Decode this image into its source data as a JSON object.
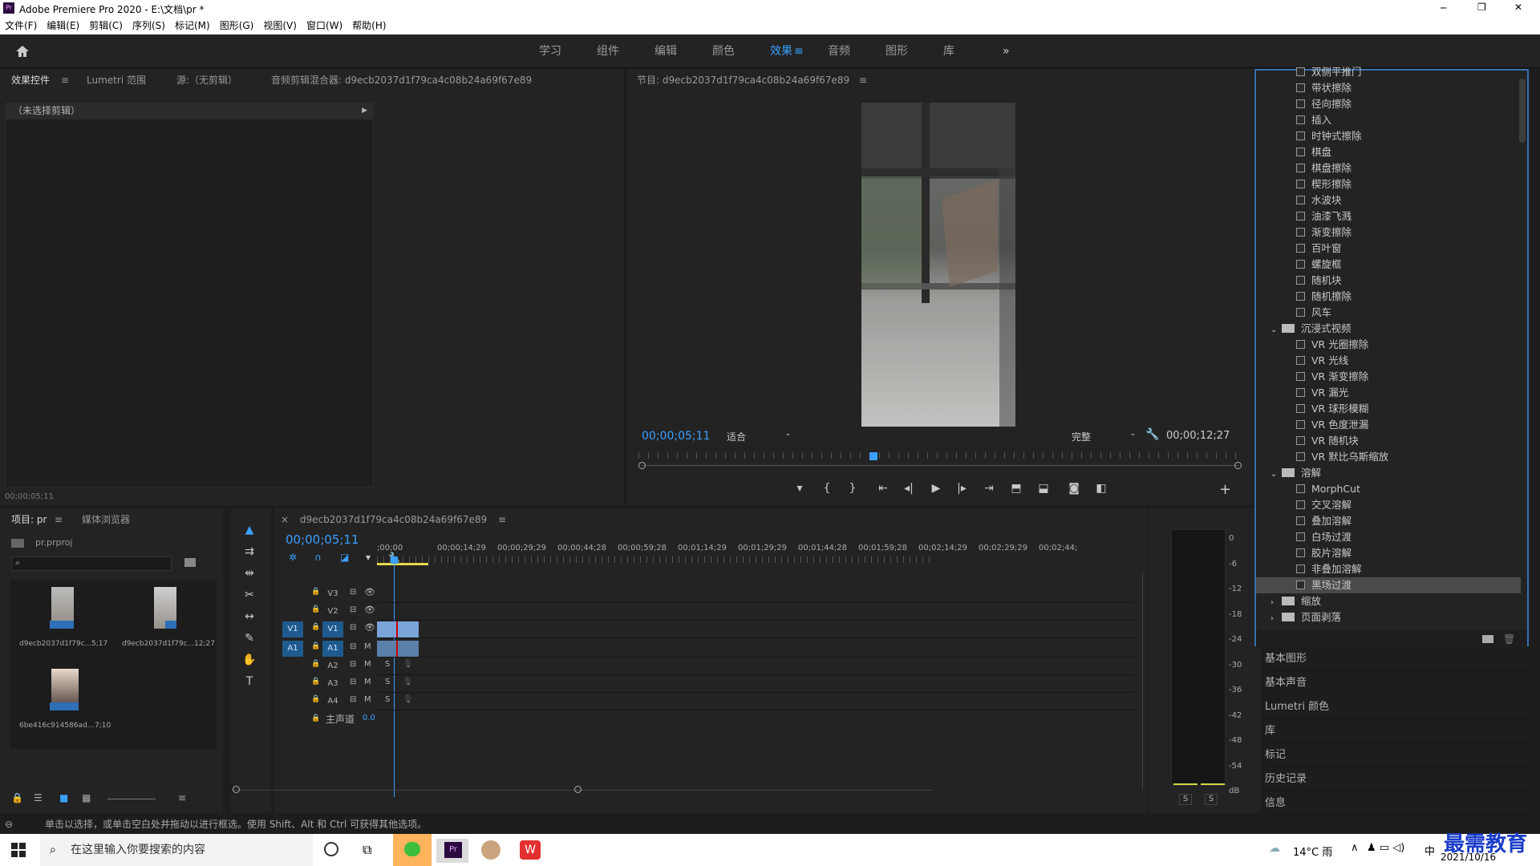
{
  "window": {
    "title": "Adobe Premiere Pro 2020 - E:\\文档\\pr *",
    "app_badge": "Pr",
    "min": "─",
    "max": "❐",
    "close": "✕"
  },
  "menu": [
    "文件(F)",
    "编辑(E)",
    "剪辑(C)",
    "序列(S)",
    "标记(M)",
    "图形(G)",
    "视图(V)",
    "窗口(W)",
    "帮助(H)"
  ],
  "workspaces": {
    "items": [
      "学习",
      "组件",
      "编辑",
      "颜色",
      "效果",
      "音频",
      "图形",
      "库"
    ],
    "active": "效果",
    "overflow": "»"
  },
  "source_panel": {
    "tabs": [
      "效果控件",
      "Lumetri 范围",
      "源:（无剪辑）",
      "音频剪辑混合器: d9ecb2037d1f79ca4c08b24a69f67e89"
    ],
    "no_clip": "（未选择剪辑）",
    "timecode": "00;00;05;11"
  },
  "program": {
    "title": "节目: d9ecb2037d1f79ca4c08b24a69f67e89",
    "timecode": "00;00;05;11",
    "fit": "适合",
    "quality": "完整",
    "duration": "00;00;12;27",
    "playhead_pct": 39
  },
  "project": {
    "tabs": [
      "项目: pr",
      "媒体浏览器"
    ],
    "file": "pr.prproj",
    "search_placeholder": "",
    "items": [
      {
        "name": "d9ecb2037d1f79c...",
        "dur": "5;17"
      },
      {
        "name": "d9ecb2037d1f79c...",
        "dur": "12;27"
      },
      {
        "name": "6be416c914586ad...",
        "dur": "7;10"
      }
    ]
  },
  "timeline": {
    "tab": "d9ecb2037d1f79ca4c08b24a69f67e89",
    "timecode": "00;00;05;11",
    "ruler": [
      ";00;00",
      "00;00;14;29",
      "00;00;29;29",
      "00;00;44;28",
      "00;00;59;28",
      "00;01;14;29",
      "00;01;29;29",
      "00;01;44;28",
      "00;01;59;28",
      "00;02;14;29",
      "00;02;29;29",
      "00;02;44;"
    ],
    "video_tracks": [
      "V3",
      "V2",
      "V1"
    ],
    "audio_tracks": [
      "A1",
      "A2",
      "A3",
      "A4"
    ],
    "src_v": "V1",
    "src_a": "A1",
    "master": "主声道",
    "master_val": "0.0",
    "m": "M",
    "s": "S"
  },
  "meter": {
    "ticks": [
      "0",
      "-6",
      "-12",
      "-18",
      "-24",
      "-30",
      "-36",
      "-42",
      "-48",
      "-54",
      "dB"
    ],
    "solo": [
      "S",
      "S"
    ]
  },
  "effects": {
    "items": [
      {
        "t": "c",
        "label": "双侧平推门"
      },
      {
        "t": "c",
        "label": "带状擦除"
      },
      {
        "t": "c",
        "label": "径向擦除"
      },
      {
        "t": "c",
        "label": "插入"
      },
      {
        "t": "c",
        "label": "时钟式擦除"
      },
      {
        "t": "c",
        "label": "棋盘"
      },
      {
        "t": "c",
        "label": "棋盘擦除"
      },
      {
        "t": "c",
        "label": "楔形擦除"
      },
      {
        "t": "c",
        "label": "水波块"
      },
      {
        "t": "c",
        "label": "油漆飞溅"
      },
      {
        "t": "c",
        "label": "渐变擦除"
      },
      {
        "t": "c",
        "label": "百叶窗"
      },
      {
        "t": "c",
        "label": "螺旋框"
      },
      {
        "t": "c",
        "label": "随机块"
      },
      {
        "t": "c",
        "label": "随机擦除"
      },
      {
        "t": "c",
        "label": "风车"
      },
      {
        "t": "f",
        "label": "沉浸式视频",
        "open": true
      },
      {
        "t": "c",
        "label": "VR 光圈擦除"
      },
      {
        "t": "c",
        "label": "VR 光线"
      },
      {
        "t": "c",
        "label": "VR 渐变擦除"
      },
      {
        "t": "c",
        "label": "VR 漏光"
      },
      {
        "t": "c",
        "label": "VR 球形模糊"
      },
      {
        "t": "c",
        "label": "VR 色度泄漏"
      },
      {
        "t": "c",
        "label": "VR 随机块"
      },
      {
        "t": "c",
        "label": "VR 默比乌斯缩放"
      },
      {
        "t": "f",
        "label": "溶解",
        "open": true
      },
      {
        "t": "c",
        "label": "MorphCut"
      },
      {
        "t": "c",
        "label": "交叉溶解"
      },
      {
        "t": "c",
        "label": "叠加溶解"
      },
      {
        "t": "c",
        "label": "白场过渡"
      },
      {
        "t": "c",
        "label": "胶片溶解"
      },
      {
        "t": "c",
        "label": "非叠加溶解"
      },
      {
        "t": "c",
        "label": "黑场过渡",
        "selected": true
      },
      {
        "t": "f",
        "label": "缩放",
        "open": false
      },
      {
        "t": "f",
        "label": "页面剥落",
        "open": false
      }
    ]
  },
  "right_panels": [
    "基本图形",
    "基本声音",
    "Lumetri 颜色",
    "库",
    "标记",
    "历史记录",
    "信息"
  ],
  "status": "单击以选择，或单击空白处并拖动以进行框选。使用 Shift、Alt 和 Ctrl 可获得其他选项。",
  "taskbar": {
    "search": "在这里输入你要搜索的内容",
    "weather": "14°C 雨",
    "time": "2021/10/16",
    "ime": "中",
    "watermark": "最需教育"
  }
}
